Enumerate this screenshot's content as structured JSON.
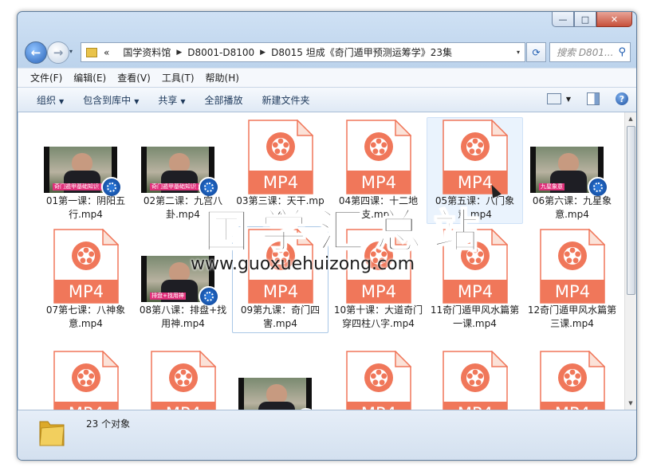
{
  "window": {
    "minimize": "—",
    "maximize": "□",
    "close": "✕"
  },
  "address": {
    "recent_glyph": "▾",
    "root_chevron": "«",
    "crumbs": [
      "国学资料馆",
      "D8001-D8100",
      "D8015 坦成《奇门遁甲预测运筹学》23集"
    ],
    "dropdown": "▾",
    "search_placeholder": "搜索 D801..."
  },
  "menu": [
    "文件(F)",
    "编辑(E)",
    "查看(V)",
    "工具(T)",
    "帮助(H)"
  ],
  "toolbar": {
    "organize": "组织",
    "include": "包含到库中",
    "share": "共享",
    "play_all": "全部播放",
    "new_folder": "新建文件夹",
    "arrow": "▼",
    "help": "?"
  },
  "files": [
    {
      "name": "01第一课：阴阳五行.mp4",
      "kind": "video",
      "caption": "奇门遁甲基础知识 阴阳五行"
    },
    {
      "name": "02第二课：九宫八卦.mp4",
      "kind": "video",
      "caption": "奇门遁甲基础知识 九宫八卦"
    },
    {
      "name": "03第三课：天干.mp4",
      "kind": "doc"
    },
    {
      "name": "04第四课：十二地支.mp4",
      "kind": "doc"
    },
    {
      "name": "05第五课：八门象意.mp4",
      "kind": "doc"
    },
    {
      "name": "06第六课：九星象意.mp4",
      "kind": "video",
      "caption": "九星象意"
    },
    {
      "name": "07第七课：八神象意.mp4",
      "kind": "doc"
    },
    {
      "name": "08第八课：排盘+找用神.mp4",
      "kind": "video",
      "caption": "排盘+找用神"
    },
    {
      "name": "09第九课：奇门四害.mp4",
      "kind": "doc"
    },
    {
      "name": "10第十课：大道奇门穿四柱八字.mp4",
      "kind": "doc"
    },
    {
      "name": "11奇门遁甲风水篇第一课.mp4",
      "kind": "doc"
    },
    {
      "name": "12奇门遁甲风水篇第三课.mp4",
      "kind": "doc"
    },
    {
      "name": "",
      "kind": "doc"
    },
    {
      "name": "",
      "kind": "doc"
    },
    {
      "name": "",
      "kind": "video",
      "caption": ""
    },
    {
      "name": "",
      "kind": "doc"
    },
    {
      "name": "",
      "kind": "doc"
    },
    {
      "name": "",
      "kind": "doc"
    }
  ],
  "doc_badge": "MP4",
  "status": {
    "count": "23 个对象"
  },
  "watermark": {
    "title": "国学汇总站",
    "url": "www.guoxuehuizong.com"
  },
  "colors": {
    "mp4_orange": "#f0775a",
    "mp4_light": "#fbe2d8",
    "selection": "#eaf3fd",
    "frame": "#bcd3ec"
  }
}
